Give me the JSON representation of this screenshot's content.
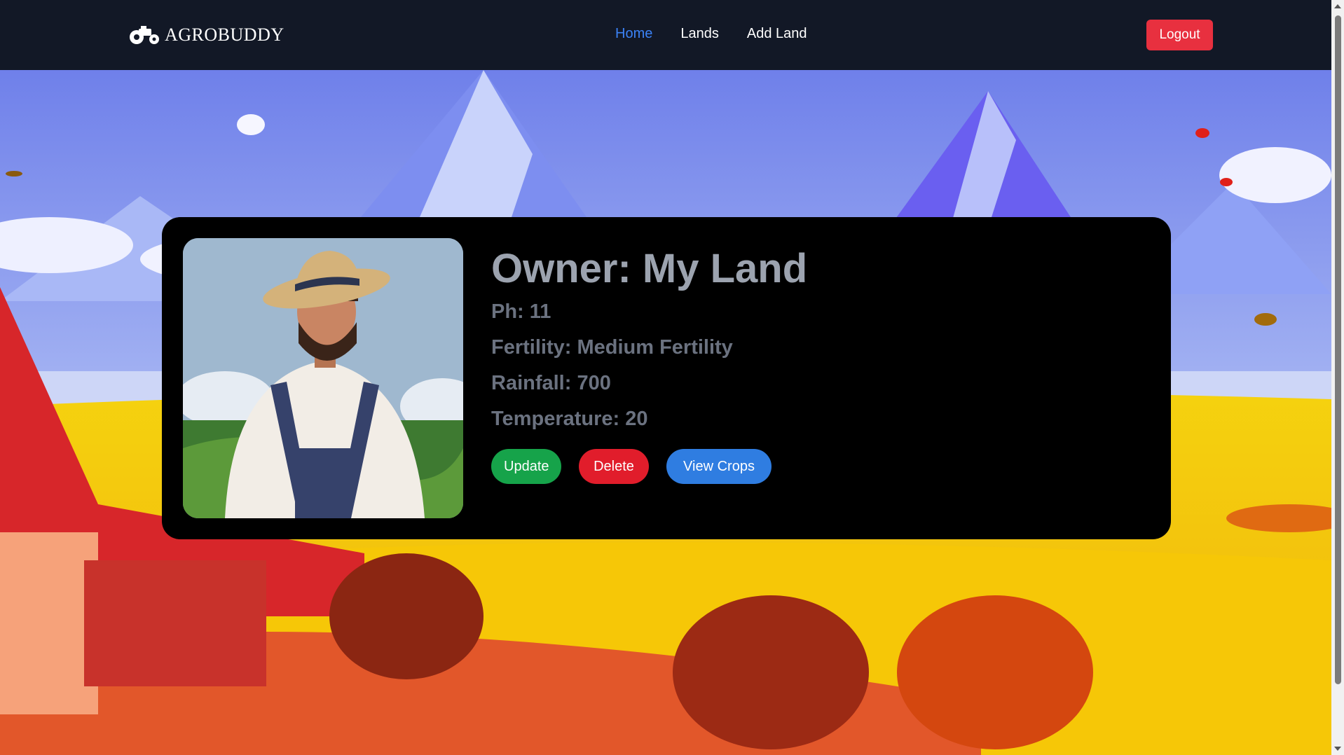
{
  "brand": {
    "name": "AGROBUDDY",
    "icon": "tractor-icon"
  },
  "nav": {
    "links": [
      {
        "label": "Home",
        "active": true
      },
      {
        "label": "Lands",
        "active": false
      },
      {
        "label": "Add Land",
        "active": false
      }
    ],
    "logout_label": "Logout"
  },
  "land": {
    "title": "Owner: My Land",
    "ph": "Ph: 11",
    "fertility": "Fertility: Medium Fertility",
    "rainfall": "Rainfall: 700",
    "temperature": "Temperature: 20"
  },
  "actions": {
    "update_label": "Update",
    "delete_label": "Delete",
    "view_crops_label": "View Crops"
  },
  "colors": {
    "navbar": "#121826",
    "active_link": "#3b82f6",
    "logout": "#e8303f",
    "update": "#16a34a",
    "delete": "#e11d2b",
    "view_crops": "#2f7de1",
    "card": "#000000"
  }
}
